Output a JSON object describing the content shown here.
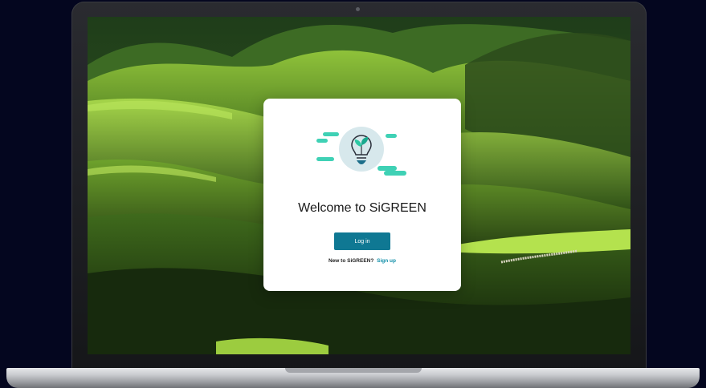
{
  "device": {
    "type": "laptop",
    "colors": {
      "bezel": "#1e1f23",
      "base": "#c9cbcf",
      "page_background": "#04061f"
    }
  },
  "wallpaper": {
    "description_icon": "green-hills-landscape"
  },
  "welcome_card": {
    "illustration_icon": "lightbulb-sprout-icon",
    "title": "Welcome to SiGREEN",
    "login_button_label": "Log in",
    "signup_prompt": "New to SiGREEN?",
    "signup_link_label": "Sign up",
    "colors": {
      "primary": "#0f7893",
      "link": "#0f8ea8",
      "accent_teal": "#3fd1b5"
    }
  }
}
